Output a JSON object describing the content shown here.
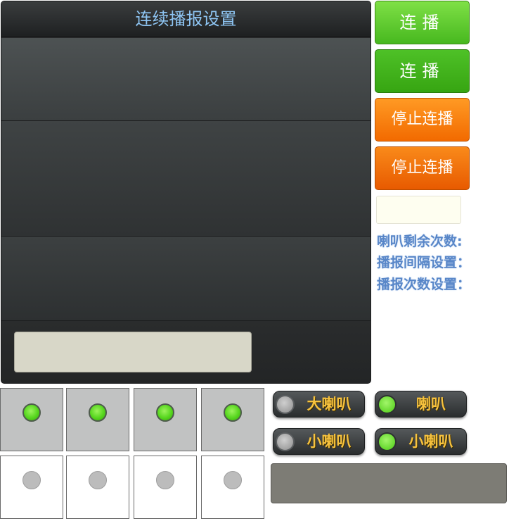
{
  "panel": {
    "title": "连续播报设置",
    "input_value": ""
  },
  "buttons": [
    {
      "label": "连播"
    },
    {
      "label": "连播"
    },
    {
      "label": "停止连播"
    },
    {
      "label": "停止连播"
    }
  ],
  "side_input": {
    "value": ""
  },
  "labels": {
    "speaker_remaining": "喇叭剩余次数:",
    "interval_setting": "播报间隔设置：",
    "count_setting": "播报次数设置："
  },
  "grid": {
    "top_row": [
      {
        "selected": true
      },
      {
        "selected": true
      },
      {
        "selected": true
      },
      {
        "selected": true
      }
    ],
    "bottom_row": [
      {
        "selected": false
      },
      {
        "selected": false
      },
      {
        "selected": false
      },
      {
        "selected": false
      }
    ]
  },
  "speaker_toggles": [
    {
      "label": "大喇叭",
      "state": "off"
    },
    {
      "label": "喇叭",
      "state": "on"
    },
    {
      "label": "小喇叭",
      "state": "off"
    },
    {
      "label": "小喇叭",
      "state": "on"
    }
  ],
  "colors": {
    "title_blue": "#8ec5f3",
    "green_button": "#47b81f",
    "orange_button": "#f26a00",
    "label_blue": "#5886c8",
    "toggle_text": "#f7c23e",
    "radio_on": "#56d61e"
  }
}
